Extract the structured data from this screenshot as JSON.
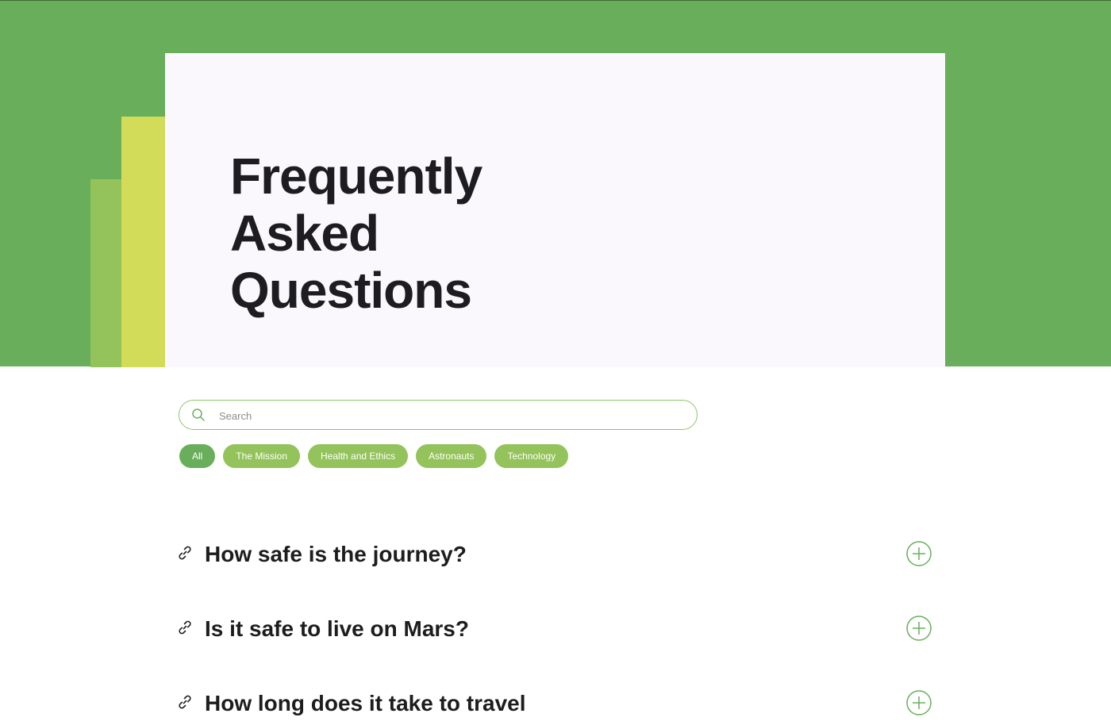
{
  "hero": {
    "title_lines": [
      "Frequently",
      "Asked",
      "Questions"
    ]
  },
  "search": {
    "placeholder": "Search",
    "icon": "search-icon"
  },
  "filters": [
    {
      "label": "All",
      "active": true
    },
    {
      "label": "The Mission",
      "active": false
    },
    {
      "label": "Health and Ethics",
      "active": false
    },
    {
      "label": "Astronauts",
      "active": false
    },
    {
      "label": "Technology",
      "active": false
    }
  ],
  "faqs": [
    {
      "question": "How safe is the journey?",
      "link_icon": "link-icon",
      "toggle_icon": "plus-circle-icon"
    },
    {
      "question": "Is it safe to live on Mars?",
      "link_icon": "link-icon",
      "toggle_icon": "plus-circle-icon"
    },
    {
      "question": "How long does it take to travel",
      "link_icon": "link-icon",
      "toggle_icon": "plus-circle-icon"
    }
  ],
  "colors": {
    "hero_green": "#69af5b",
    "accent_light_green": "#93c35a",
    "accent_yellow": "#d2dc58",
    "card_bg": "#faf8fd",
    "text_dark": "#1d1d1f"
  }
}
